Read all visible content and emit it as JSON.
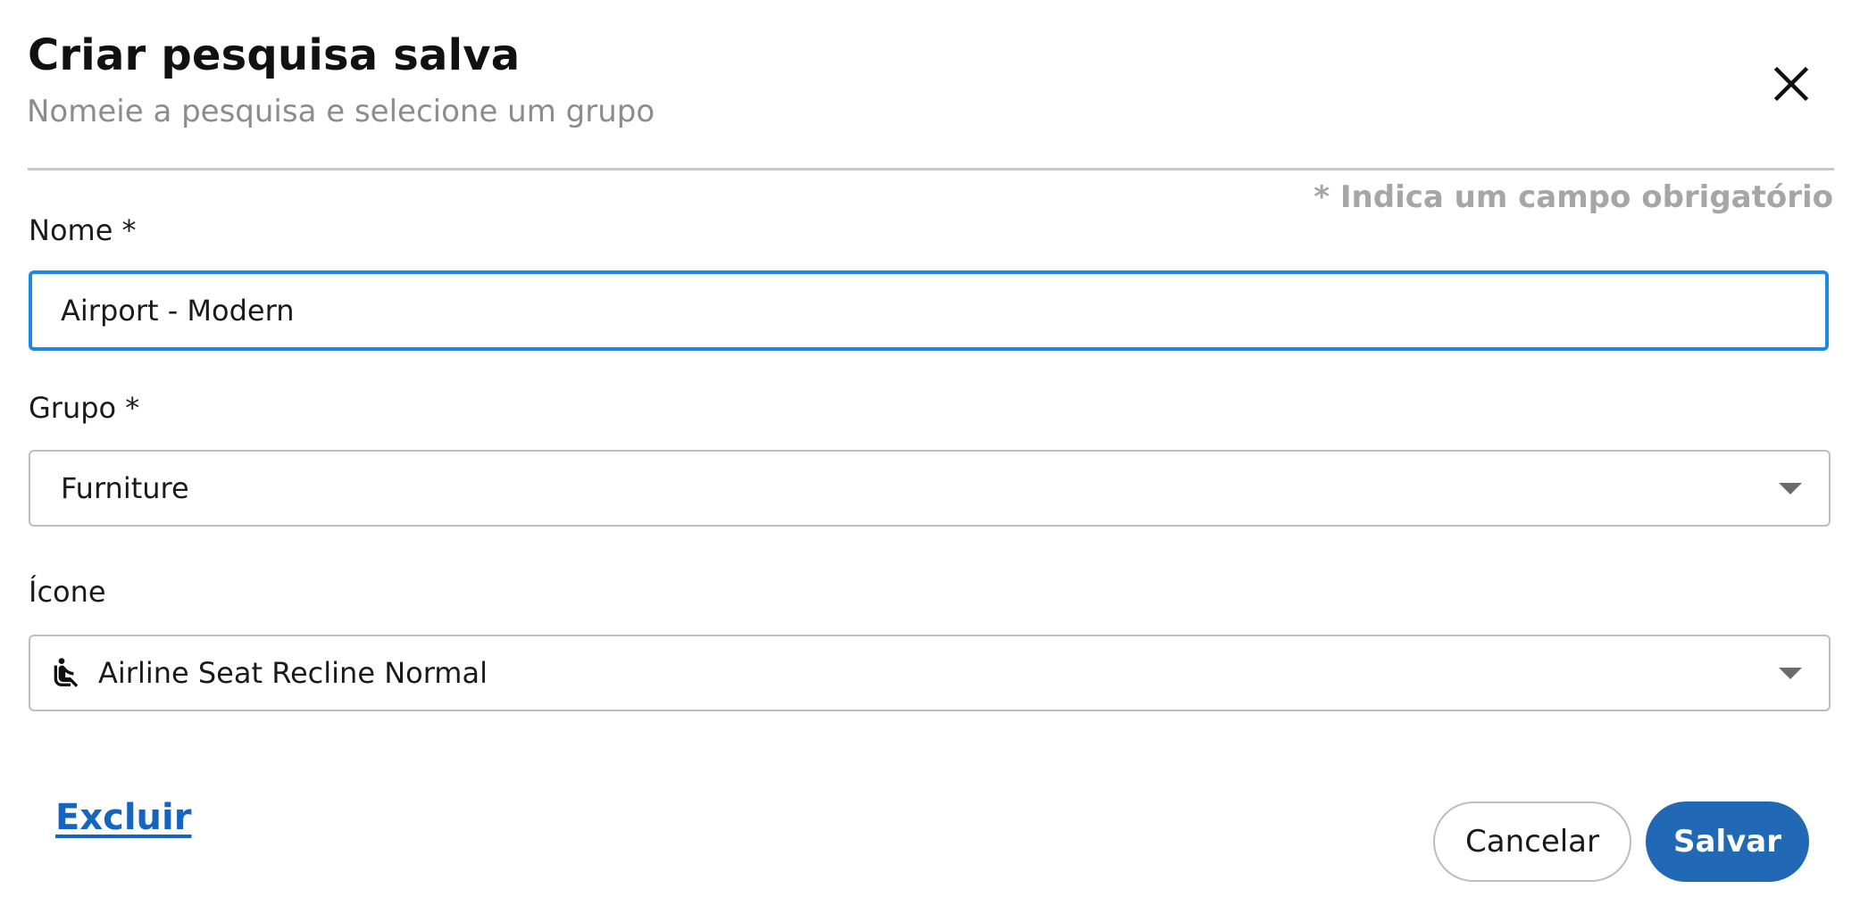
{
  "dialog": {
    "title": "Criar pesquisa salva",
    "subtitle": "Nomeie a pesquisa e selecione um grupo",
    "required_note": "* Indica um campo obrigatório"
  },
  "form": {
    "name": {
      "label": "Nome *",
      "value": "Airport - Modern"
    },
    "group": {
      "label": "Grupo *",
      "selected": "Furniture"
    },
    "icon": {
      "label": "Ícone",
      "selected": "Airline Seat Recline Normal",
      "selected_icon": "airline-seat-recline-normal-icon"
    }
  },
  "actions": {
    "delete_label": "Excluir",
    "cancel_label": "Cancelar",
    "save_label": "Salvar"
  },
  "colors": {
    "accent": "#1e88e5",
    "primary_button": "#2168b5",
    "link": "#1565c0"
  }
}
